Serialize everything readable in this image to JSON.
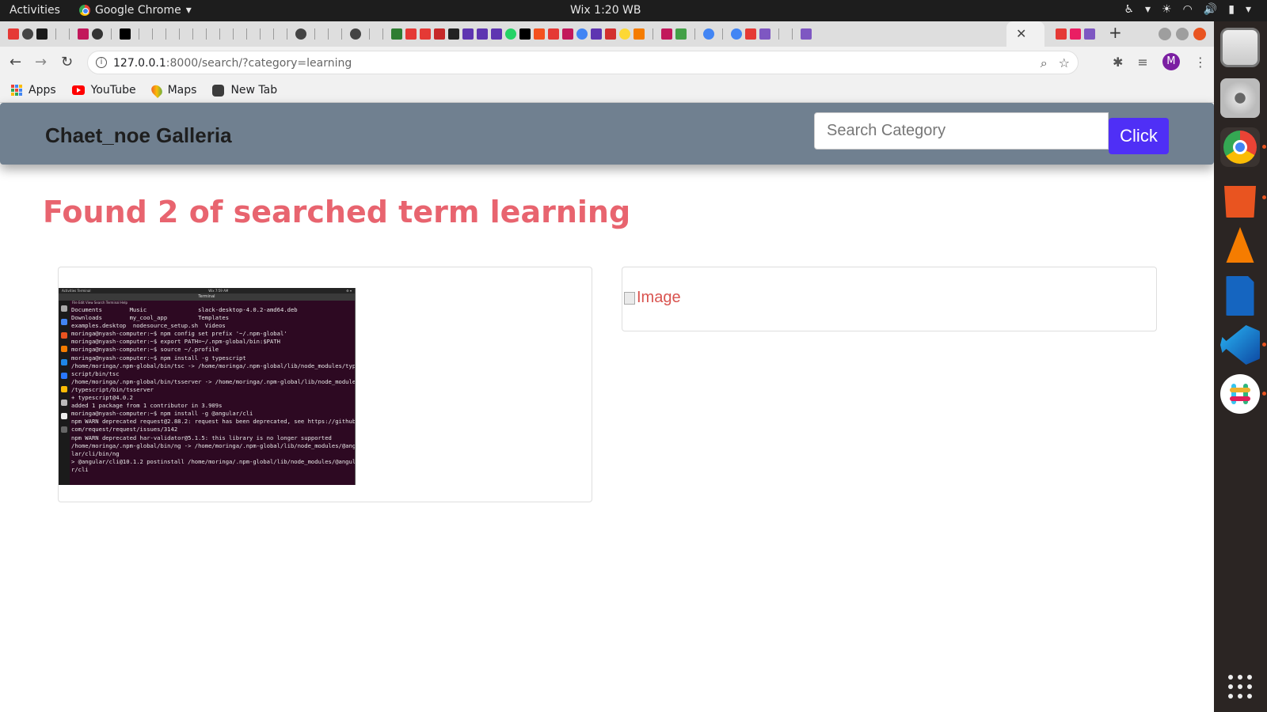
{
  "system": {
    "activities": "Activities",
    "app_name": "Google Chrome",
    "clock": "Wix  1:20 WB"
  },
  "browser": {
    "url_host": "127.0.0.1",
    "url_rest": ":8000/search/?category=learning",
    "bookmarks": [
      {
        "label": "Apps"
      },
      {
        "label": "YouTube"
      },
      {
        "label": "Maps"
      },
      {
        "label": "New Tab"
      }
    ],
    "profile_initial": "M"
  },
  "site": {
    "brand": "Chaet_noe Galleria",
    "search_placeholder": "Search Category",
    "search_button": "Click",
    "heading": "Found 2 of searched term learning",
    "results": [
      {
        "alt": "Image",
        "status": "loaded"
      },
      {
        "alt": "Image",
        "status": "broken"
      }
    ]
  },
  "thumbnail": {
    "title": "Terminal",
    "menu": "File  Edit  View  Search  Terminal  Help",
    "lines": [
      "Documents        Music               slack-desktop-4.0.2-amd64.deb",
      "Downloads        my_cool_app         Templates",
      "examples.desktop  nodesource_setup.sh  Videos",
      "moringa@nyash-computer:~$ npm config set prefix '~/.npm-global'",
      "moringa@nyash-computer:~$ export PATH=~/.npm-global/bin:$PATH",
      "moringa@nyash-computer:~$ source ~/.profile",
      "moringa@nyash-computer:~$ npm install -g typescript",
      "/home/moringa/.npm-global/bin/tsc -> /home/moringa/.npm-global/lib/node_modules/type",
      "script/bin/tsc",
      "/home/moringa/.npm-global/bin/tsserver -> /home/moringa/.npm-global/lib/node_modules",
      "/typescript/bin/tsserver",
      "+ typescript@4.0.2",
      "added 1 package from 1 contributor in 3.909s",
      "moringa@nyash-computer:~$ npm install -g @angular/cli",
      "npm WARN deprecated request@2.88.2: request has been deprecated, see https://github.",
      "com/request/request/issues/3142",
      "npm WARN deprecated har-validator@5.1.5: this library is no longer supported",
      "/home/moringa/.npm-global/bin/ng -> /home/moringa/.npm-global/lib/node_modules/@angu",
      "lar/cli/bin/ng",
      "",
      "> @angular/cli@10.1.2 postinstall /home/moringa/.npm-global/lib/node_modules/@angula",
      "r/cli"
    ]
  },
  "colors": {
    "navbar": "#708090",
    "heading": "#e8646f",
    "button": "#4f2ff6"
  }
}
